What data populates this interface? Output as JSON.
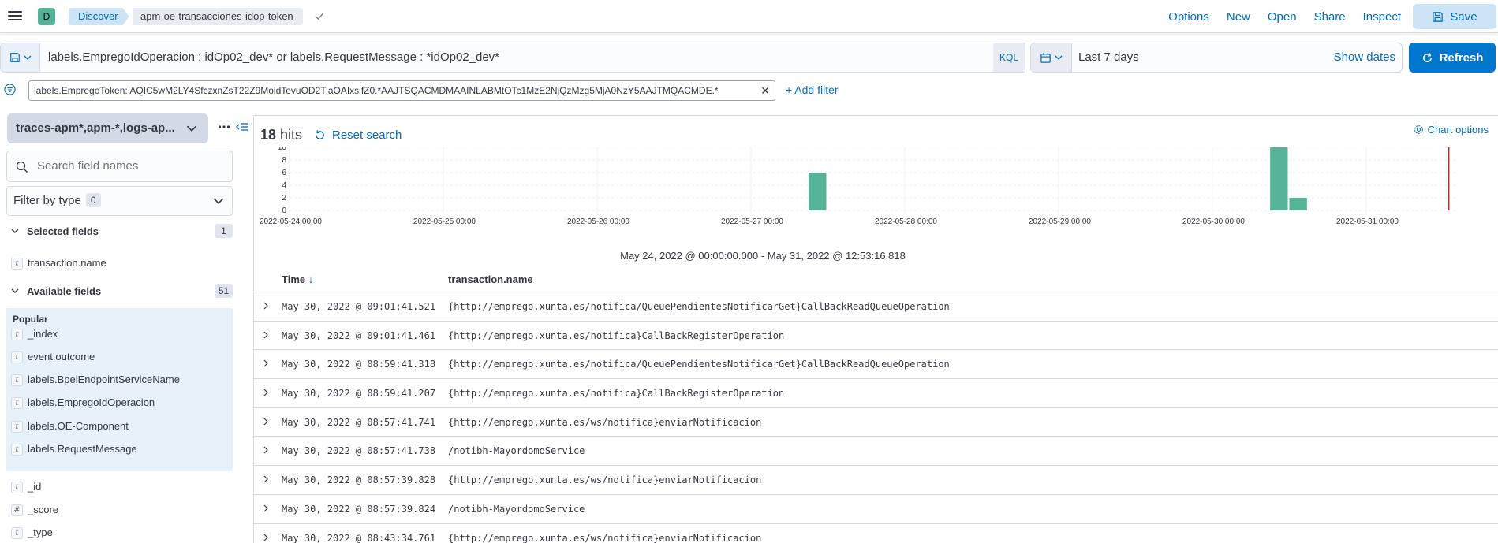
{
  "header": {
    "space_initial": "D",
    "breadcrumbs": [
      "Discover",
      "apm-oe-transacciones-idop-token"
    ],
    "links": [
      "Options",
      "New",
      "Open",
      "Share",
      "Inspect"
    ],
    "save_label": "Save",
    "accent_color": "#006bb8"
  },
  "query": {
    "text": "labels.EmpregoIdOperacion : idOp02_dev* or labels.RequestMessage : *idOp02_dev*",
    "language": "KQL"
  },
  "date": {
    "range": "Last 7 days",
    "show_dates": "Show dates",
    "refresh": "Refresh"
  },
  "filters": {
    "pill": "labels.EmpregoToken: AQIC5wM2LY4SfczxnZsT22Z9MoldTevuOD2TiaOAIxsifZ0.*AAJTSQACMDMAAINLABMtOTc1MzE2NjQzMzg5MjA0NzY5AAJTMQACMDE.*",
    "add_filter": "+ Add filter"
  },
  "sidebar": {
    "index_pattern": "traces-apm*,apm-*,logs-ap...",
    "search_placeholder": "Search field names",
    "filter_by_type": "Filter by type",
    "filter_count": "0",
    "selected_title": "Selected fields",
    "selected_count": "1",
    "selected_fields": [
      {
        "type": "t",
        "name": "transaction.name"
      }
    ],
    "available_title": "Available fields",
    "available_count": "51",
    "popular_title": "Popular",
    "popular_fields": [
      {
        "type": "t",
        "name": "_index"
      },
      {
        "type": "t",
        "name": "event.outcome"
      },
      {
        "type": "t",
        "name": "labels.BpelEndpointServiceName"
      },
      {
        "type": "t",
        "name": "labels.EmpregoIdOperacion"
      },
      {
        "type": "t",
        "name": "labels.OE-Component"
      },
      {
        "type": "t",
        "name": "labels.RequestMessage"
      }
    ],
    "other_fields": [
      {
        "type": "t",
        "name": "_id"
      },
      {
        "type": "#",
        "name": "_score"
      },
      {
        "type": "t",
        "name": "_type"
      }
    ]
  },
  "main": {
    "hits_count": "18",
    "hits_label": "hits",
    "reset_search": "Reset search",
    "chart_options": "Chart options",
    "range_caption": "May 24, 2022 @ 00:00:00.000 - May 31, 2022 @ 12:53:16.818",
    "columns": [
      "Time",
      "transaction.name"
    ],
    "rows": [
      {
        "time": "May 30, 2022 @ 09:01:41.521",
        "name": "{http://emprego.xunta.es/notifica/QueuePendientesNotificarGet}CallBackReadQueueOperation"
      },
      {
        "time": "May 30, 2022 @ 09:01:41.461",
        "name": "{http://emprego.xunta.es/notifica}CallBackRegisterOperation"
      },
      {
        "time": "May 30, 2022 @ 08:59:41.318",
        "name": "{http://emprego.xunta.es/notifica/QueuePendientesNotificarGet}CallBackReadQueueOperation"
      },
      {
        "time": "May 30, 2022 @ 08:59:41.207",
        "name": "{http://emprego.xunta.es/notifica}CallBackRegisterOperation"
      },
      {
        "time": "May 30, 2022 @ 08:57:41.741",
        "name": "{http://emprego.xunta.es/ws/notifica}enviarNotificacion"
      },
      {
        "time": "May 30, 2022 @ 08:57:41.738",
        "name": "/notibh-MayordomoService"
      },
      {
        "time": "May 30, 2022 @ 08:57:39.828",
        "name": "{http://emprego.xunta.es/ws/notifica}enviarNotificacion"
      },
      {
        "time": "May 30, 2022 @ 08:57:39.824",
        "name": "/notibh-MayordomoService"
      },
      {
        "time": "May 30, 2022 @ 08:43:34.761",
        "name": "{http://emprego.xunta.es/ws/notifica}enviarNotificacion"
      }
    ]
  },
  "chart_data": {
    "type": "bar",
    "x_ticks": [
      "2022-05-24 00:00",
      "2022-05-25 00:00",
      "2022-05-26 00:00",
      "2022-05-27 00:00",
      "2022-05-28 00:00",
      "2022-05-29 00:00",
      "2022-05-30 00:00",
      "2022-05-31 00:00"
    ],
    "y_ticks": [
      0,
      2,
      4,
      6,
      8,
      10
    ],
    "ylim": [
      0,
      10
    ],
    "bars": [
      {
        "x": "2022-05-27 09:00",
        "value": 6
      },
      {
        "x": "2022-05-30 09:00",
        "value": 10
      },
      {
        "x": "2022-05-30 12:00",
        "value": 2
      }
    ],
    "now_marker": "2022-05-31 12:53",
    "bar_color": "#54b399",
    "marker_color": "#bd271e"
  }
}
